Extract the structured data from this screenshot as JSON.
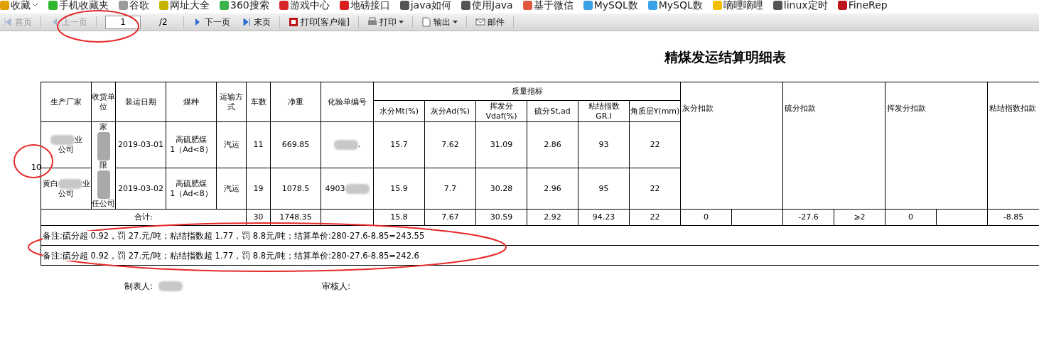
{
  "bookmarks": [
    {
      "label": "收藏",
      "color": "#e0a000",
      "dropdown": true
    },
    {
      "label": "手机收藏夹",
      "color": "#2fb52f",
      "dropdown": false
    },
    {
      "label": "谷歌",
      "color": "#9a9a9a",
      "dropdown": false
    },
    {
      "label": "网址大全",
      "color": "#c8b400",
      "dropdown": false
    },
    {
      "label": "360搜索",
      "color": "#3bb34a",
      "dropdown": false
    },
    {
      "label": "游戏中心",
      "color": "#d8252a",
      "dropdown": false
    },
    {
      "label": "地磅接口",
      "color": "#d81e1e",
      "dropdown": false
    },
    {
      "label": "java如何",
      "color": "#555555",
      "dropdown": false
    },
    {
      "label": "使用Java",
      "color": "#555555",
      "dropdown": false
    },
    {
      "label": "基于微信",
      "color": "#e2583e",
      "dropdown": false
    },
    {
      "label": "MySQL数",
      "color": "#3aa0e8",
      "dropdown": false
    },
    {
      "label": "MySQL数",
      "color": "#3aa0e8",
      "dropdown": false
    },
    {
      "label": "嘀哩嘀哩",
      "color": "#f0c000",
      "dropdown": false
    },
    {
      "label": "linux定时",
      "color": "#555555",
      "dropdown": false
    },
    {
      "label": "FineRep",
      "color": "#c0141c",
      "dropdown": false
    }
  ],
  "toolbar": {
    "before": [
      {
        "label": "首页",
        "kind": "first",
        "disabled": true,
        "dropdown": false
      },
      {
        "label": "上一页",
        "kind": "prev",
        "disabled": true,
        "dropdown": false
      }
    ],
    "page_value": "1",
    "page_total": "/2",
    "after": [
      {
        "label": "下一页",
        "kind": "next",
        "disabled": false,
        "dropdown": false
      },
      {
        "label": "末页",
        "kind": "last",
        "disabled": false,
        "dropdown": false
      },
      {
        "label": "打印[客户端]",
        "kind": "flash",
        "disabled": false,
        "dropdown": false
      },
      {
        "label": "打印",
        "kind": "printer",
        "disabled": false,
        "dropdown": true
      },
      {
        "label": "输出",
        "kind": "export",
        "disabled": false,
        "dropdown": true
      },
      {
        "label": "邮件",
        "kind": "mail",
        "disabled": false,
        "dropdown": false
      }
    ]
  },
  "report": {
    "title": "精煤发运结算明细表",
    "row_marker": "10",
    "head": [
      "生产厂家",
      "收货单位",
      "装运日期",
      "煤种",
      "运输方式",
      "车数",
      "净重",
      "化验单编号"
    ],
    "quality_group": "质量指标",
    "quality_columns": [
      "水分Mt(%)",
      "灰分Ad(%)",
      "挥发分\nVdaf(%)",
      "硫分St,ad",
      "粘结指数\nGR.I",
      "角质层Y(mm)"
    ],
    "deduction_columns": [
      "灰分扣款",
      "硫分扣款",
      "挥发分扣款",
      "粘结指数扣款"
    ],
    "receiver": [
      {
        "kind": "text",
        "text": "家"
      },
      {
        "kind": "blur"
      },
      {
        "kind": "text",
        "text": "限"
      },
      {
        "kind": "blur"
      },
      {
        "kind": "text",
        "text": "任公司"
      }
    ],
    "rows": [
      {
        "producer": [
          {
            "kind": "blur"
          },
          {
            "kind": "text",
            "text": "业"
          },
          {
            "kind": "break"
          },
          {
            "kind": "text",
            "text": "公司"
          }
        ],
        "date": "2019-03-01",
        "coal_type": "高硫肥煤\n1（Ad<8）",
        "transport": "汽运",
        "cars": "11",
        "net_weight": "669.85",
        "lab_no": [
          {
            "kind": "blur"
          },
          {
            "kind": "text",
            "text": "."
          }
        ],
        "quality": [
          "15.7",
          "7.62",
          "31.09",
          "2.86",
          "93",
          "22"
        ]
      },
      {
        "producer": [
          {
            "kind": "text",
            "text": "黄白"
          },
          {
            "kind": "blur"
          },
          {
            "kind": "text",
            "text": "业"
          },
          {
            "kind": "break"
          },
          {
            "kind": "text",
            "text": "公司"
          }
        ],
        "date": "2019-03-02",
        "coal_type": "高硫肥煤\n1（Ad<8）",
        "transport": "汽运",
        "cars": "19",
        "net_weight": "1078.5",
        "lab_no": [
          {
            "kind": "text",
            "text": "4903"
          },
          {
            "kind": "blur"
          }
        ],
        "quality": [
          "15.9",
          "7.7",
          "30.28",
          "2.96",
          "95",
          "22"
        ]
      }
    ],
    "total": {
      "label": "合计:",
      "cells": [
        "30",
        "1748.35",
        null,
        "15.8",
        "7.67",
        "30.59",
        "2.92",
        "94.23",
        "22",
        "0",
        null,
        "-27.6",
        "⩾2",
        "0",
        null,
        "-8.85"
      ]
    },
    "remarks": [
      "备注:硫分超 0.92，罚 27.元/吨；粘结指数超 1.77，罚 8.8元/吨；结算单价:280-27.6-8.85=243.55",
      "备注:硫分超 0.92，罚 27.元/吨；粘结指数超 1.77，罚 8.8元/吨；结算单价:280-27.6-8.85=242.6"
    ],
    "signatures": [
      {
        "label": "制表人:",
        "blurred": true
      },
      {
        "label": "审核人:",
        "blurred": false
      }
    ]
  }
}
